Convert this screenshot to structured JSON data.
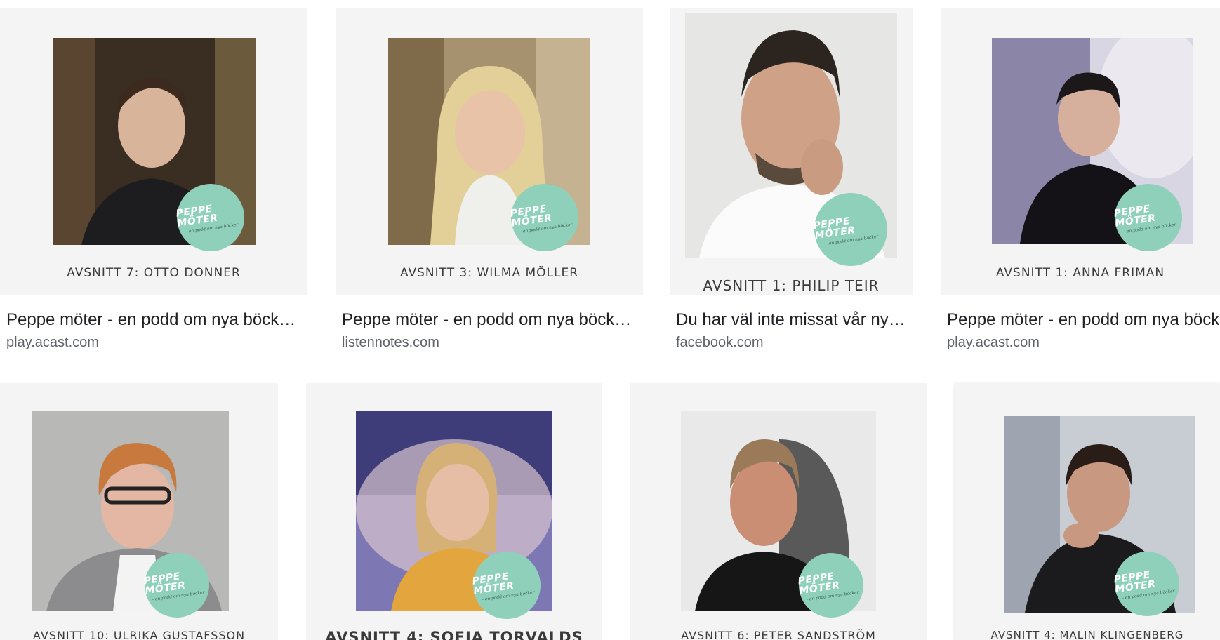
{
  "results": [
    {
      "caption": "AVSNITT 7: OTTO DONNER",
      "title": "Peppe möter - en podd om nya böck…",
      "source": "play.acast.com",
      "badge_main": "PEPPE MÖTER",
      "badge_sub": "- en podd om nya böcker"
    },
    {
      "caption": "AVSNITT 3: WILMA MÖLLER",
      "title": "Peppe möter - en podd om nya böck…",
      "source": "listennotes.com",
      "badge_main": "PEPPE MÖTER",
      "badge_sub": "- en podd om nya böcker"
    },
    {
      "caption": "AVSNITT 1: PHILIP TEIR",
      "title": "Du har väl inte missat vår ny…",
      "source": "facebook.com",
      "badge_main": "PEPPE MÖTER",
      "badge_sub": "- en podd om nya böcker"
    },
    {
      "caption": "AVSNITT 1: ANNA FRIMAN",
      "title": "Peppe möter - en podd om nya böck",
      "source": "play.acast.com",
      "badge_main": "PEPPE MÖTER",
      "badge_sub": "- en podd om nya böcker"
    },
    {
      "caption": "AVSNITT 10: ULRIKA GUSTAFSSON",
      "badge_main": "PEPPE MÖTER",
      "badge_sub": "- en podd om nya böcker"
    },
    {
      "caption": "AVSNITT 4: SOFIA TORVALDS",
      "badge_main": "PEPPE MÖTER",
      "badge_sub": "- en podd om nya böcker"
    },
    {
      "caption": "AVSNITT 6: PETER SANDSTRÖM",
      "badge_main": "PEPPE MÖTER",
      "badge_sub": "- en podd om nya böcker"
    },
    {
      "caption": "AVSNITT 4: MALIN KLINGENBERG",
      "badge_main": "PEPPE MÖTER",
      "badge_sub": "- en podd om nya böcker"
    }
  ],
  "colors": {
    "badge": "#8fd0bb",
    "thumb_bg": "#f4f4f4",
    "title": "#202124",
    "source": "#5f6368"
  }
}
